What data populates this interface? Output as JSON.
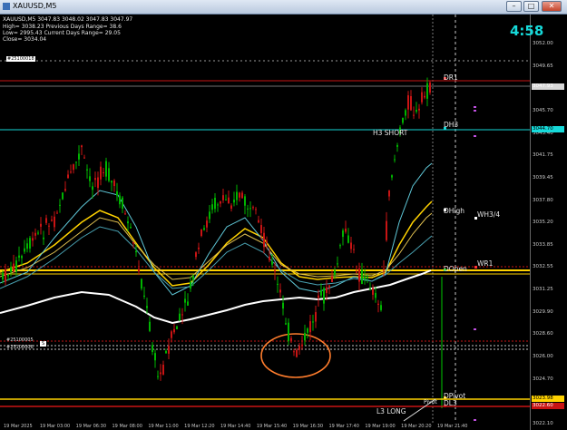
{
  "window": {
    "title": "XAUUSD,M5",
    "minimize_glyph": "–",
    "maximize_glyph": "□",
    "close_glyph": "✕",
    "app_icon": "metatrader-chart-icon"
  },
  "header": {
    "symbol_line": "XAUUSD,M5  3047.83 3048.02 3047.83 3047.97",
    "info_lines": [
      "High= 3038.23   Previous Days Range= 38.6",
      "Low= 2995.43   Current Days Range= 29.05",
      "Close= 3034.04"
    ]
  },
  "countdown": "4:58",
  "price_axis": {
    "ticks": [
      "3052.00",
      "3049.65",
      "3047.00",
      "3045.70",
      "3043.40",
      "3041.75",
      "3039.45",
      "3037.80",
      "3035.20",
      "3033.85",
      "3032.55",
      "3031.25",
      "3029.90",
      "3028.60",
      "3026.00",
      "3024.70",
      "3023.40",
      "3022.10"
    ],
    "labels": [
      {
        "text": "3047.93",
        "color": "#ffffff",
        "bg": "#d7d7d7"
      },
      {
        "text": "3044.70",
        "color": "#000000",
        "bg": "#16d9d9"
      },
      {
        "text": "3023.98",
        "color": "#000000",
        "bg": "#ffd200"
      },
      {
        "text": "3022.60",
        "color": "#ffffff",
        "bg": "#c81414"
      }
    ]
  },
  "time_axis": {
    "ticks": [
      "19 Mar 2025",
      "19 Mar 03:00",
      "19 Mar 06:30",
      "19 Mar 08:00",
      "19 Mar 11:00",
      "19 Mar 12:20",
      "19 Mar 14:40",
      "19 Mar 15:40",
      "19 Mar 16:30",
      "19 Mar 17:40",
      "19 Mar 19:00",
      "19 Mar 20:20",
      "19 Mar 21:40"
    ]
  },
  "levels": {
    "dr1": "DR1",
    "dh3": "DH3",
    "h3_short": "H3 SHORT",
    "dhigh": "DHigh",
    "wh34": "WH3/4",
    "wr1": "WR1",
    "dopen": "DOpen",
    "dpivot": "DPivot",
    "pivot": "Pivot",
    "dl3": "DL3",
    "l3_long": "L3 LONG"
  },
  "object_tags": {
    "top": "#25100018",
    "bottom_1": "#25100005",
    "bottom_2": "#25100006",
    "bottom_box": "S"
  },
  "colors": {
    "background": "#000000",
    "bull": "#00b400",
    "bear": "#c81414",
    "cyan": "#16d9d9",
    "yellow": "#ffd200",
    "ellipse": "#ff7d2d"
  }
}
